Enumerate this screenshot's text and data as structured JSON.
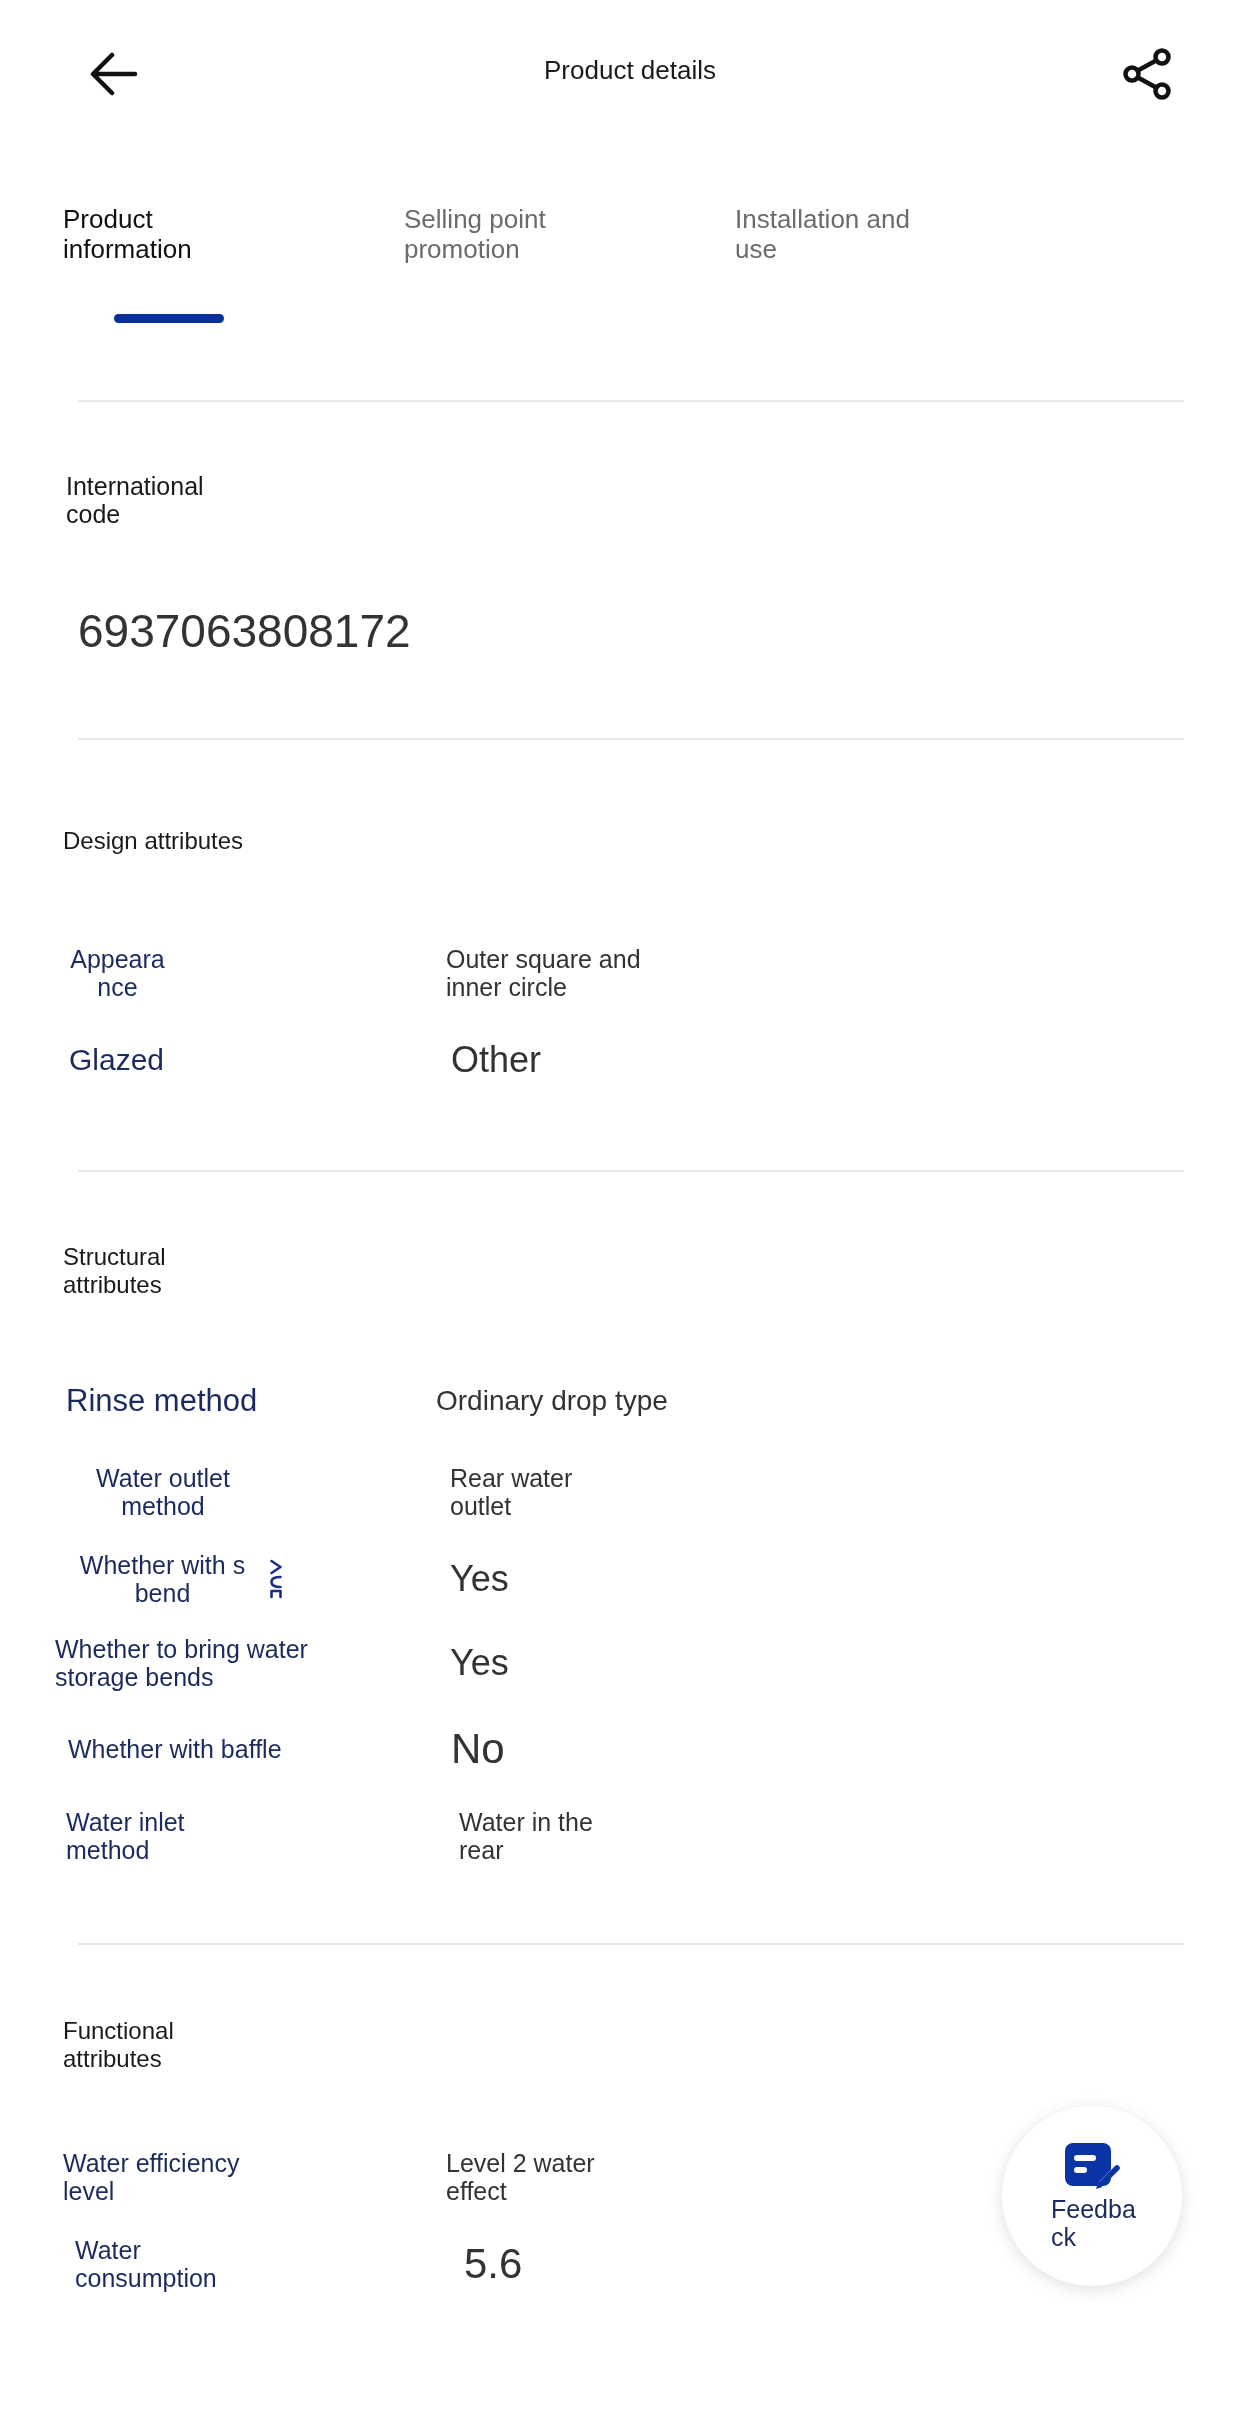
{
  "header": {
    "title": "Product details"
  },
  "tabs": [
    {
      "label": "Product information",
      "selected": true
    },
    {
      "label": "Selling point promotion",
      "selected": false
    },
    {
      "label": "Installation and use",
      "selected": false
    }
  ],
  "international_code": {
    "label": "International code",
    "value": "6937063808172"
  },
  "sections": [
    {
      "title": "Design attributes",
      "rows": [
        {
          "label": "Appearance",
          "value": "Outer square and inner circle"
        },
        {
          "label": "Glazed",
          "value": "Other"
        }
      ]
    },
    {
      "title": "Structural attributes",
      "rows": [
        {
          "label": "Rinse method",
          "value": "Ordinary drop type"
        },
        {
          "label": "Water outlet method",
          "value": "Rear water outlet"
        },
        {
          "label": "Whether with s bend",
          "value": "Yes"
        },
        {
          "label": "Whether to bring water storage bends",
          "value": "Yes"
        },
        {
          "label": "Whether with baffle",
          "value": "No"
        },
        {
          "label": "Water inlet method",
          "value": "Water in the rear"
        }
      ]
    },
    {
      "title": "Functional attributes",
      "rows": [
        {
          "label": "Water efficiency level",
          "value": "Level 2 water effect"
        },
        {
          "label": "Water consumption",
          "value": "5.6"
        }
      ]
    }
  ],
  "feedback_button": {
    "label": "Feedback"
  }
}
